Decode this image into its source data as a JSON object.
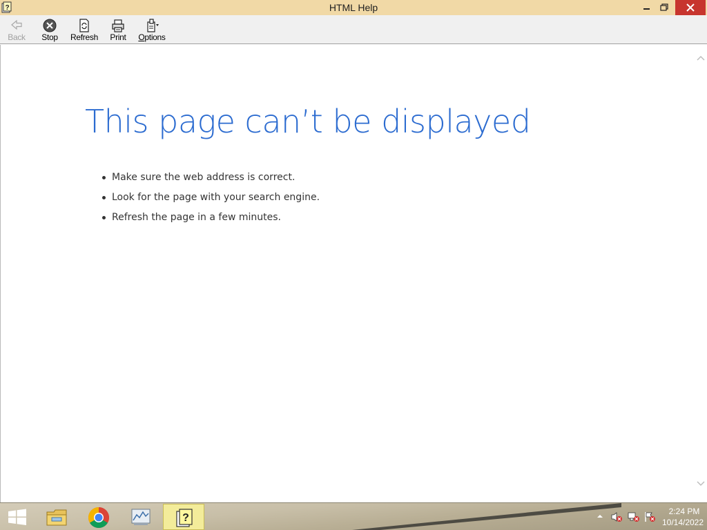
{
  "window": {
    "title": "HTML Help",
    "icons": {
      "app": "help-book-icon",
      "minimize": "minimize-icon",
      "maximize": "restore-icon",
      "close": "close-icon"
    },
    "colors": {
      "titlebar": "#f1d9a6",
      "close": "#c7352e"
    }
  },
  "toolbar": {
    "back_label": "Back",
    "stop_label": "Stop",
    "refresh_label": "Refresh",
    "print_label": "Print",
    "options_label_first": "O",
    "options_label_rest": "ptions"
  },
  "content": {
    "title": "This page can’t be displayed",
    "bullets": [
      "Make sure the web address  is correct.",
      "Look for the page with your search engine.",
      "Refresh the page in a few minutes."
    ],
    "title_color": "#2b6bd0"
  },
  "taskbar": {
    "items": [
      {
        "icon": "file-explorer-icon"
      },
      {
        "icon": "chrome-icon"
      },
      {
        "icon": "performance-monitor-icon"
      },
      {
        "icon": "help-icon",
        "active": true
      }
    ],
    "tray": {
      "icons": [
        "show-hidden-icons-arrow",
        "speaker-muted-icon",
        "network-disconnected-icon",
        "action-center-flag-icon"
      ],
      "time": "2:24 PM",
      "date": "10/14/2022"
    }
  }
}
